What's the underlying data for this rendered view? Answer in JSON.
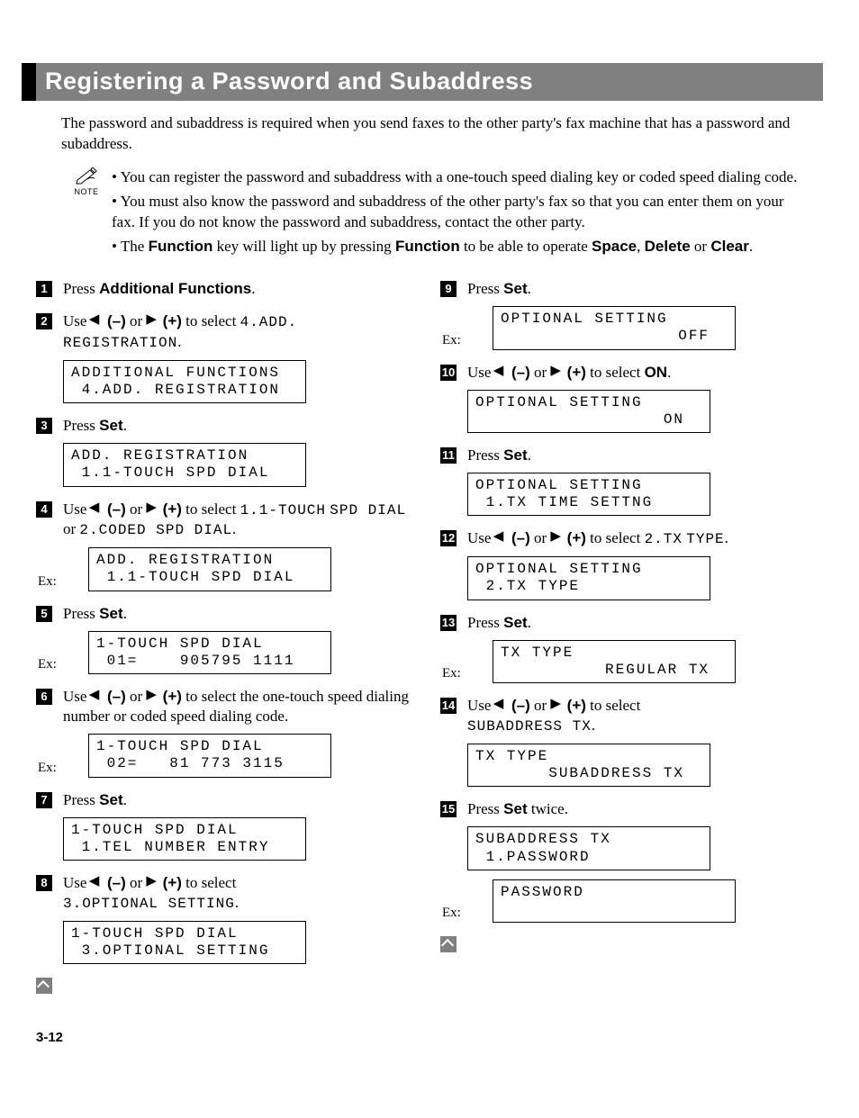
{
  "title": "Registering a Password and Subaddress",
  "intro": "The password and subaddress is required when you send faxes to the other party's fax machine that has a password and subaddress.",
  "note_label": "NOTE",
  "notes": [
    "You can register the password and subaddress with a one-touch speed dialing key or coded speed dialing code.",
    "You must also know the password and subaddress of the other party's fax so that you can enter them on your fax. If you do not know the password and subaddress, contact the other party."
  ],
  "note_function_prefix": "The ",
  "note_function_key": "Function",
  "note_function_mid": " key will light up by pressing ",
  "note_function_mid2": " to be able to operate ",
  "note_function_space": "Space",
  "note_function_comma": ", ",
  "note_function_delete": "Delete",
  "note_function_or": " or ",
  "note_function_clear": "Clear",
  "note_function_period": ".",
  "left": {
    "s1": {
      "num": "1",
      "prefix": "Press ",
      "bold": "Additional Functions",
      "suffix": "."
    },
    "s2": {
      "num": "2",
      "text_a": "Use ",
      "minus": "(–)",
      "or": " or ",
      "plus": "(+)",
      "text_b": " to select ",
      "mono_a": "4.ADD.",
      "mono_b": "REGISTRATION",
      "period": ".",
      "display": "ADDITIONAL FUNCTIONS\n 4.ADD. REGISTRATION"
    },
    "s3": {
      "num": "3",
      "prefix": "Press ",
      "bold": "Set",
      "suffix": ".",
      "display": "ADD. REGISTRATION\n 1.1-TOUCH SPD DIAL"
    },
    "s4": {
      "num": "4",
      "text_a": "Use ",
      "minus": "(–)",
      "or": " or ",
      "plus": "(+)",
      "text_b": " to select ",
      "mono_a": "1.1-TOUCH",
      "br": " ",
      "mono_b": "SPD DIAL",
      "mid": " or ",
      "mono_c": "2.CODED SPD DIAL",
      "period": ".",
      "ex": "Ex:",
      "display": "ADD. REGISTRATION\n 1.1-TOUCH SPD DIAL"
    },
    "s5": {
      "num": "5",
      "prefix": "Press ",
      "bold": "Set",
      "suffix": ".",
      "ex": "Ex:",
      "display": "1-TOUCH SPD DIAL\n 01=    905795 1111"
    },
    "s6": {
      "num": "6",
      "text_a": "Use ",
      "minus": "(–)",
      "or": " or ",
      "plus": "(+)",
      "text_b": " to select the one-touch speed dialing number or coded speed dialing code.",
      "ex": "Ex:",
      "display": "1-TOUCH SPD DIAL\n 02=   81 773 3115"
    },
    "s7": {
      "num": "7",
      "prefix": "Press ",
      "bold": "Set",
      "suffix": ".",
      "display": "1-TOUCH SPD DIAL\n 1.TEL NUMBER ENTRY"
    },
    "s8": {
      "num": "8",
      "text_a": "Use ",
      "minus": "(–)",
      "or": " or ",
      "plus": "(+)",
      "text_b": " to select",
      "mono_a": "3.OPTIONAL SETTING",
      "period": ".",
      "display": "1-TOUCH SPD DIAL\n 3.OPTIONAL SETTING"
    }
  },
  "right": {
    "s9": {
      "num": "9",
      "prefix": "Press ",
      "bold": "Set",
      "suffix": ".",
      "ex": "Ex:",
      "display": "OPTIONAL SETTING\n                 OFF"
    },
    "s10": {
      "num": "10",
      "text_a": "Use ",
      "minus": "(–)",
      "or": " or ",
      "plus": "(+)",
      "text_b": " to select ",
      "bold": "ON",
      "period": ".",
      "display": "OPTIONAL SETTING\n                  ON"
    },
    "s11": {
      "num": "11",
      "prefix": "Press ",
      "bold": "Set",
      "suffix": ".",
      "display": "OPTIONAL SETTING\n 1.TX TIME SETTNG"
    },
    "s12": {
      "num": "12",
      "text_a": "Use ",
      "minus": "(–)",
      "or": " or ",
      "plus": "(+)",
      "text_b": " to select ",
      "mono_a": "2.TX",
      "br": " ",
      "mono_b": "TYPE",
      "period": ".",
      "display": "OPTIONAL SETTING\n 2.TX TYPE"
    },
    "s13": {
      "num": "13",
      "prefix": "Press ",
      "bold": "Set",
      "suffix": ".",
      "ex": "Ex:",
      "display": "TX TYPE\n          REGULAR TX"
    },
    "s14": {
      "num": "14",
      "text_a": "Use ",
      "minus": "(–)",
      "or": " or ",
      "plus": "(+)",
      "text_b": " to select",
      "mono_a": "SUBADDRESS TX",
      "period": ".",
      "display": "TX TYPE\n       SUBADDRESS TX"
    },
    "s15": {
      "num": "15",
      "prefix": "Press ",
      "bold": "Set",
      "suffix": " twice.",
      "ex": "Ex:",
      "display1": "SUBADDRESS TX\n 1.PASSWORD",
      "display2": "PASSWORD\n "
    }
  },
  "page_number": "3-12"
}
